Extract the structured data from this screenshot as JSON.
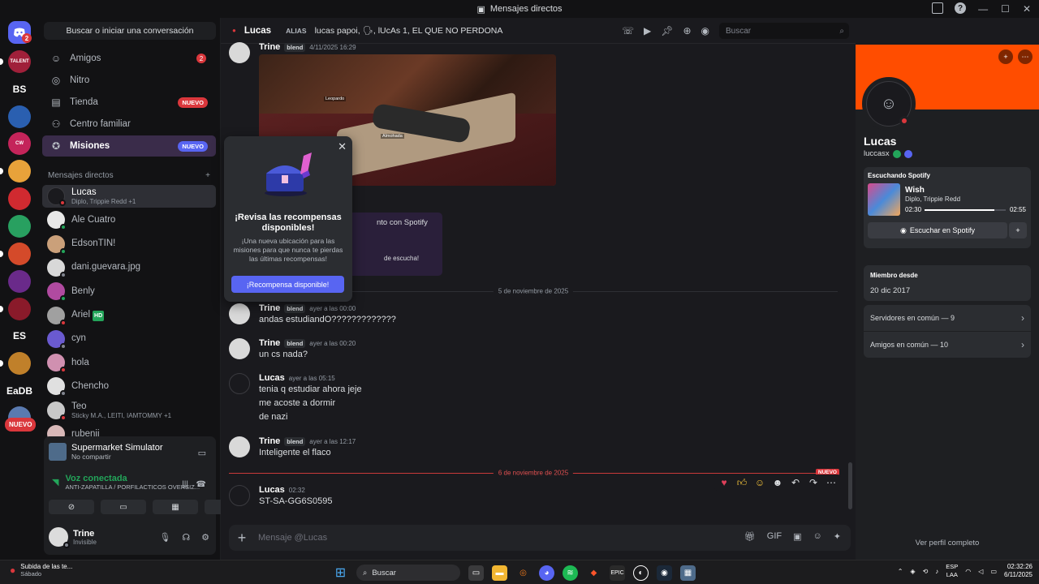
{
  "window": {
    "title": "Mensajes directos"
  },
  "rail": {
    "home_badge": "2",
    "text_servers": [
      "BS",
      "ES",
      "EaDB"
    ],
    "nuevo_label": "NUEVO",
    "servers": [
      {
        "label": "TALENT",
        "color": "#a0203a"
      },
      {
        "label": "",
        "color": "#2a5fb0"
      },
      {
        "label": "CW",
        "color": "#c4245a"
      },
      {
        "label": "",
        "color": "#e8a23a"
      },
      {
        "label": "",
        "color": "#d02a30"
      },
      {
        "label": "",
        "color": "#28a060"
      },
      {
        "label": "",
        "color": "#d44a2a"
      },
      {
        "label": "",
        "color": "#6a2a8a"
      },
      {
        "label": "",
        "color": "#8a1a2a"
      },
      {
        "label": "",
        "color": "#c0802a"
      },
      {
        "label": "",
        "color": "#5a7ab0"
      }
    ]
  },
  "sidebar": {
    "search_label": "Buscar o iniciar una conversación",
    "nav": [
      {
        "label": "Amigos",
        "icon": "friends-icon",
        "badge": "2"
      },
      {
        "label": "Nitro",
        "icon": "nitro-icon"
      },
      {
        "label": "Tienda",
        "icon": "shop-icon",
        "pill": "NUEVO"
      },
      {
        "label": "Centro familiar",
        "icon": "family-icon"
      },
      {
        "label": "Misiones",
        "icon": "quests-icon",
        "pill": "NUEVO"
      }
    ],
    "dm_header": "Mensajes directos",
    "dms": [
      {
        "name": "Lucas",
        "sub": "Diplo, Trippie Redd +1",
        "status": "dnd"
      },
      {
        "name": "Ale Cuatro",
        "sub": "",
        "status": "on"
      },
      {
        "name": "EdsonTIN!",
        "sub": "",
        "status": "on"
      },
      {
        "name": "dani.guevara.jpg",
        "sub": "",
        "status": "off"
      },
      {
        "name": "Benly",
        "sub": "",
        "status": "on"
      },
      {
        "name": "Ariel",
        "sub": "",
        "status": "dnd",
        "tag": "HD"
      },
      {
        "name": "cyn",
        "sub": "",
        "status": "off"
      },
      {
        "name": "hola",
        "sub": "",
        "status": "dnd"
      },
      {
        "name": "Chencho",
        "sub": "",
        "status": "off"
      },
      {
        "name": "Teo",
        "sub": "Sticky M.A., LEITI, IAMTOMMY +1",
        "status": "dnd"
      },
      {
        "name": "rubenji",
        "sub": "",
        "status": "off"
      }
    ]
  },
  "panel": {
    "activity_title": "Supermarket Simulator",
    "activity_sub": "No compartir",
    "voice_title": "Voz conectada",
    "voice_sub": "ANTI-ZAPATILLA / PORFILACTICOS OVERSIZ...",
    "user_name": "Trine",
    "user_status": "Invisible"
  },
  "chat": {
    "header_name": "Lucas",
    "alias_label": "ALIAS",
    "alias_value": "lucas papoi, 🗣, lUcAs 1, EL QUE NO PERDONA",
    "search_placeholder": "Buscar",
    "first": {
      "author": "Trine",
      "tag": "blend",
      "time": "4/11/2025 16:29"
    },
    "image_labels": [
      "Leopardo",
      "Almohada"
    ],
    "spotify_snippet_1": "nto con Spotify",
    "spotify_snippet_2": "de escucha!",
    "date1": "5 de noviembre de 2025",
    "date2": "6 de noviembre de 2025",
    "new_flag": "NUEVO",
    "messages": [
      {
        "author": "Trine",
        "tag": "blend",
        "time": "ayer a las 00:00",
        "lines": [
          "andas estudiandO?????????????"
        ]
      },
      {
        "author": "Trine",
        "tag": "blend",
        "time": "ayer a las 00:20",
        "lines": [
          "un cs nada?"
        ]
      },
      {
        "author": "Lucas",
        "tag": "",
        "time": "ayer a las 05:15",
        "lines": [
          "tenia q estudiar ahora jeje",
          "me acoste a dormir",
          "de nazi"
        ]
      },
      {
        "author": "Trine",
        "tag": "blend",
        "time": "ayer a las 12:17",
        "lines": [
          "Inteligente el flaco"
        ]
      },
      {
        "author": "Lucas",
        "tag": "",
        "time": "02:32",
        "lines": [
          "ST-SA-GG6S0595"
        ]
      }
    ],
    "composer_placeholder": "Mensaje @Lucas"
  },
  "popup": {
    "title": "¡Revisa las recompensas disponibles!",
    "body": "¡Una nueva ubicación para las misiones para que nunca te pierdas las últimas recompensas!",
    "button": "¡Recompensa disponible!"
  },
  "profile": {
    "banner_color": "#ff4d00",
    "name": "Lucas",
    "username": "luccasx",
    "spotify_header": "Escuchando Spotify",
    "track": "Wish",
    "artist": "Diplo, Trippie Redd",
    "elapsed": "02:30",
    "total": "02:55",
    "progress": 0.86,
    "spotify_button": "Escuchar en Spotify",
    "member_since_label": "Miembro desde",
    "member_since": "20 dic 2017",
    "mutual_servers": "Servidores en común — 9",
    "mutual_friends": "Amigos en común — 10",
    "full_profile": "Ver perfil completo"
  },
  "taskbar": {
    "notif_title": "Subida de las te...",
    "notif_sub": "Sábado",
    "search_label": "Buscar",
    "lang": "ESP",
    "lang_sub": "LAA",
    "time": "02:32:26",
    "date": "6/11/2025"
  }
}
